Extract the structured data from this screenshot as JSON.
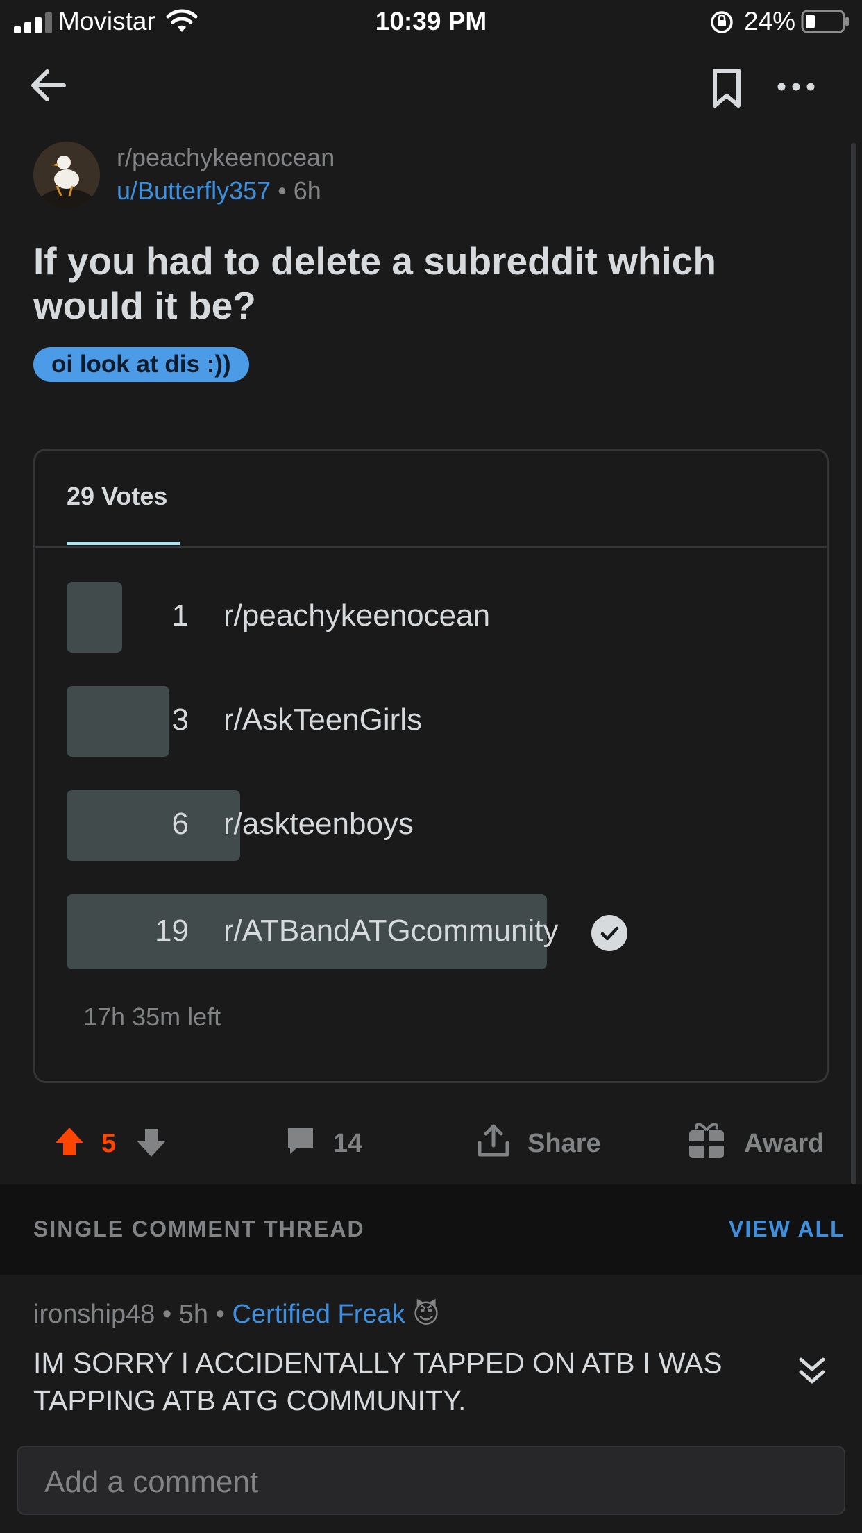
{
  "status_bar": {
    "carrier": "Movistar",
    "time": "10:39 PM",
    "battery_pct": "24%"
  },
  "post": {
    "subreddit": "r/peachykeenocean",
    "author": "u/Butterfly357",
    "age": "6h",
    "title": "If you had to delete a subreddit which would it be?",
    "flair": "oi look at dis :))"
  },
  "poll": {
    "votes_label": "29 Votes",
    "options": [
      {
        "count": "1",
        "label": "r/peachykeenocean",
        "share": 0.053
      },
      {
        "count": "3",
        "label": "r/AskTeenGirls",
        "share": 0.158
      },
      {
        "count": "6",
        "label": "r/askteenboys",
        "share": 0.316
      },
      {
        "count": "19",
        "label": "r/ATBandATGcommunity",
        "share": 1.0,
        "selected": true
      }
    ],
    "time_left": "17h 35m left"
  },
  "actions": {
    "score": "5",
    "comments": "14",
    "share": "Share",
    "award": "Award"
  },
  "thread": {
    "label": "SINGLE COMMENT THREAD",
    "view_all": "VIEW ALL"
  },
  "comment": {
    "author": "ironship48",
    "age": "5h",
    "flair": "Certified Freak",
    "flair_emoji": "😈",
    "body": "IM SORRY I ACCIDENTALLY TAPPED ON ATB I WAS TAPPING ATB ATG COMMUNITY."
  },
  "composer": {
    "placeholder": "Add a comment"
  },
  "colors": {
    "background": "#1a1a1b",
    "upvote": "#ff4500",
    "link": "#3d8fe0",
    "flair_bg": "#4b9be6",
    "poll_bar": "#414b4c"
  }
}
